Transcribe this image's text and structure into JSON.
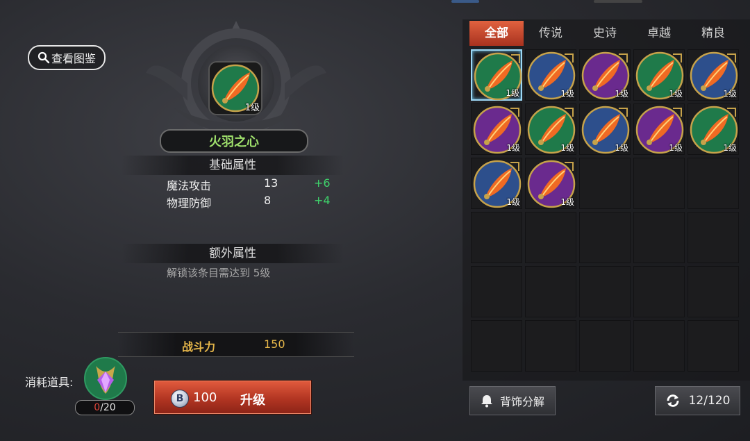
{
  "left": {
    "view_atlas_label": "查看图鉴",
    "item": {
      "name": "火羽之心",
      "level_label": "1级",
      "name_color": "#9fe06c"
    },
    "base_attrs": {
      "title": "基础属性",
      "rows": [
        {
          "name": "魔法攻击",
          "value": "13",
          "bonus": "+6"
        },
        {
          "name": "物理防御",
          "value": "8",
          "bonus": "+4"
        }
      ]
    },
    "extra_attrs": {
      "title": "额外属性",
      "unlock_text": "解锁该条目需达到 5级"
    },
    "power": {
      "label": "战斗力",
      "value": "150"
    },
    "consume": {
      "label": "消耗道具:",
      "count_have": "0",
      "count_sep_total": "/20"
    },
    "upgrade": {
      "coin_letter": "B",
      "cost": "100",
      "label": "升级"
    }
  },
  "right": {
    "tabs": [
      {
        "label": "全部",
        "active": true
      },
      {
        "label": "传说",
        "active": false
      },
      {
        "label": "史诗",
        "active": false
      },
      {
        "label": "卓越",
        "active": false
      },
      {
        "label": "精良",
        "active": false
      }
    ],
    "grid": {
      "columns": 5,
      "rows": 6,
      "items": [
        {
          "bg": "green",
          "level": "1级",
          "selected": true
        },
        {
          "bg": "blue",
          "level": "1级"
        },
        {
          "bg": "purple",
          "level": "1级"
        },
        {
          "bg": "green",
          "level": "1级"
        },
        {
          "bg": "blue",
          "level": "1级"
        },
        {
          "bg": "purple",
          "level": "1级"
        },
        {
          "bg": "green",
          "level": "1级"
        },
        {
          "bg": "blue",
          "level": "1级"
        },
        {
          "bg": "purple",
          "level": "1级"
        },
        {
          "bg": "green",
          "level": "1级"
        },
        {
          "bg": "blue",
          "level": "1级"
        },
        {
          "bg": "purple",
          "level": "1级"
        }
      ]
    },
    "decompose_label": "背饰分解",
    "capacity": "12/120"
  },
  "colors": {
    "accent_red": "#c0402a",
    "power_gold": "#e8b84a",
    "bonus_green": "#3fd36b",
    "bg_green": "#1f7a4a",
    "bg_blue": "#2d4f8c",
    "bg_purple": "#6a2a8e"
  },
  "icons": [
    "search-icon",
    "feather-icon",
    "bell-icon",
    "refresh-icon",
    "coin-icon",
    "crystal-icon"
  ]
}
